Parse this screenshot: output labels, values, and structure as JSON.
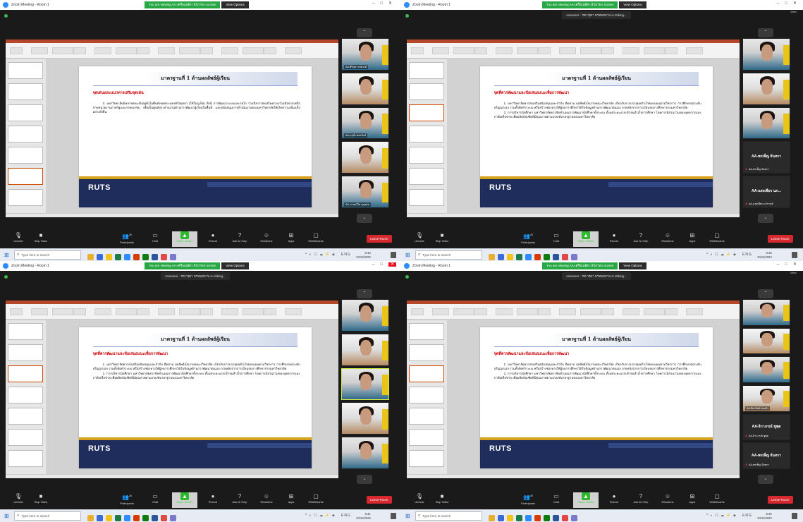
{
  "window": {
    "title": "Zoom Meeting - Room 1",
    "view_label": "View"
  },
  "share_banner": {
    "text": "You are viewing AA-เครือเนลิตา ธีรภาพ's screen",
    "options": "View Options"
  },
  "speaker": {
    "talking": "Assessor - รศ.กรุตา พรหมสถาน is talking..."
  },
  "slides": [
    {
      "title": "มาตรฐานที่ 1 ด้านผลลัพธ์ผู้เรียน",
      "heading": "จุดเด่นและแนวทางเสริมจุดเด่น",
      "paragraphs": [
        "3. มหาวิทยาลัยมีหลายคณะตั้งอยู่ทั้งในพื้นที่เขตพระนครศรีอยุธยา (ใช้ในภูเก็ต) ทั้งนี้ การพัฒนาระบบและกลไก รวมถึงการส่งเสริมความร่วมมือจากเครือข่ายหน่วยงานภาครัฐและภาคเอกชน เพื่อเป็นศูนย์ประสานงานด้านการพัฒนาผู้เรียนในพื้นที่ และสนับสนุนการดำเนินงานของมหาวิทยาลัยให้เกิดความเข้มแข็งอย่างยั่งยืน"
      ]
    },
    {
      "title": "มาตรฐานที่ 1 ด้านผลลัพธ์ผู้เรียน",
      "heading": "จุดที่ควรพัฒนาและข้อเสนอแนะเพื่อการพัฒนา",
      "paragraphs": [
        "1. มหาวิทยาลัยควรส่งเสริมสนับสนุนและกำกับ ติดตาม ผลลัพธ์เป็นรายคณะ/วิทยาลัย เกี่ยวกับการบรรลุผลสำเร็จของแผนตามวิชาการ การศึกษาต่อระดับปริญญาเอก รวมทั้งจัดทำระบบ หรือสร้างช่องทางให้ผู้จบการศึกษาได้รับข้อมูลด้านการพัฒนาตนเอง ภายหลังจากการเรียนจบการศึกษาจากมหาวิทยาลัย",
        "2. การบริหารนักศึกษา มหาวิทยาลัยควรจัดทำแผนการพัฒนานักศึกษาทั้งระบบ ตั้งแต่ระยะแรกเข้าจนสำเร็จการศึกษา โดยการมีส่วนร่วมของบุคลากรและภาคีเครือข่าย เพื่อผลิตบัณฑิตที่มีคุณภาพตามเกณฑ์มาตรฐานของมหาวิทยาลัย"
      ]
    },
    {
      "title": "มาตรฐานที่ 1 ด้านผลลัพธ์ผู้เรียน",
      "heading": "จุดที่ควรพัฒนาและข้อเสนอแนะเพื่อการพัฒนา",
      "paragraphs": [
        "1. มหาวิทยาลัยควรส่งเสริมสนับสนุนและกำกับ ติดตาม ผลลัพธ์เป็นรายคณะ/วิทยาลัย เกี่ยวกับการบรรลุผลสำเร็จของแผนตามวิชาการ การศึกษาต่อระดับปริญญาเอก รวมทั้งจัดทำระบบ หรือสร้างช่องทางให้ผู้จบการศึกษาได้รับข้อมูลด้านการพัฒนาตนเอง ภายหลังจากการเรียนจบการศึกษาจากมหาวิทยาลัย",
        "2. การบริหารนักศึกษา มหาวิทยาลัยควรจัดทำแผนการพัฒนานักศึกษาทั้งระบบ ตั้งแต่ระยะแรกเข้าจนสำเร็จการศึกษา โดยการมีส่วนร่วมของบุคลากรและภาคีเครือข่าย เพื่อผลิตบัณฑิตที่มีคุณภาพตามเกณฑ์มาตรฐานของมหาวิทยาลัย"
      ]
    },
    {
      "title": "มาตรฐานที่ 1 ด้านผลลัพธ์ผู้เรียน",
      "heading": "จุดที่ควรพัฒนาและข้อเสนอแนะเพื่อการพัฒนา",
      "paragraphs": [
        "1. มหาวิทยาลัยควรส่งเสริมสนับสนุนและกำกับ ติดตาม ผลลัพธ์เป็นรายคณะ/วิทยาลัย เกี่ยวกับการบรรลุผลสำเร็จของแผนตามวิชาการ การศึกษาต่อระดับปริญญาเอก รวมทั้งจัดทำระบบ หรือสร้างช่องทางให้ผู้จบการศึกษาได้รับข้อมูลด้านการพัฒนาตนเอง ภายหลังจากการเรียนจบการศึกษาจากมหาวิทยาลัย",
        "2. การบริหารนักศึกษา มหาวิทยาลัยควรจัดทำแผนการพัฒนานักศึกษาทั้งระบบ ตั้งแต่ระยะแรกเข้าจนสำเร็จการศึกษา โดยการมีส่วนร่วมของบุคลากรและภาคีเครือข่าย เพื่อผลิตบัณฑิตที่มีคุณภาพตามเกณฑ์มาตรฐานของมหาวิทยาลัย"
      ]
    }
  ],
  "slide_logo": "RUTS",
  "participants": {
    "q1": [
      "AA-ศิรินุชา เทพวงศ์",
      "",
      "AA-อรุณี เพชรรัตน์",
      "",
      "AA-วรรณวิไล บุญช่วย"
    ],
    "q2": [
      "",
      "",
      "",
      "AA-พรเพ็ญ จันทรา",
      "AA-แสงเพียร นภ..."
    ],
    "q2_small": [
      "",
      "",
      "",
      "AA-พรเพ็ญ จันทรา",
      "AA-แสงเพียร นภ์กานต์"
    ],
    "q3": [
      "",
      "",
      "",
      "",
      ""
    ],
    "q4": [
      "",
      "",
      "",
      "AA-ธิดารัตน์ ทองคำ",
      "AA-ธิวาภรณ์ ชูพุด",
      "AA-พรเพ็ญ จันทรา"
    ],
    "q4_small": [
      "",
      "",
      "",
      "",
      "AA-ธิวาภรณ์ ชูพุด",
      "AA-พรเพ็ญ จันทรา"
    ]
  },
  "toolbar": {
    "unmute": "Unmute",
    "stop_video": "Stop Video",
    "participants": "Participants",
    "participants_count": "26",
    "chat": "Chat",
    "share_screen": "Share Screen",
    "record": "Record",
    "ask_help": "Ask for Help",
    "reactions": "Reactions",
    "apps": "Apps",
    "whiteboards": "Whiteboards",
    "leave": "Leave Room"
  },
  "taskbar": {
    "search_placeholder": "Type here to search",
    "times": [
      "8:40",
      "8:40",
      "8:41",
      "8:40"
    ],
    "date": "10/11/2023",
    "lang": "ENG"
  },
  "colors": {
    "zoom_blue": "#2d8cff",
    "share_green": "#28a745",
    "leave_red": "#d72830",
    "slide_navy": "#1f2d5c",
    "slide_gold": "#d7a21b"
  }
}
